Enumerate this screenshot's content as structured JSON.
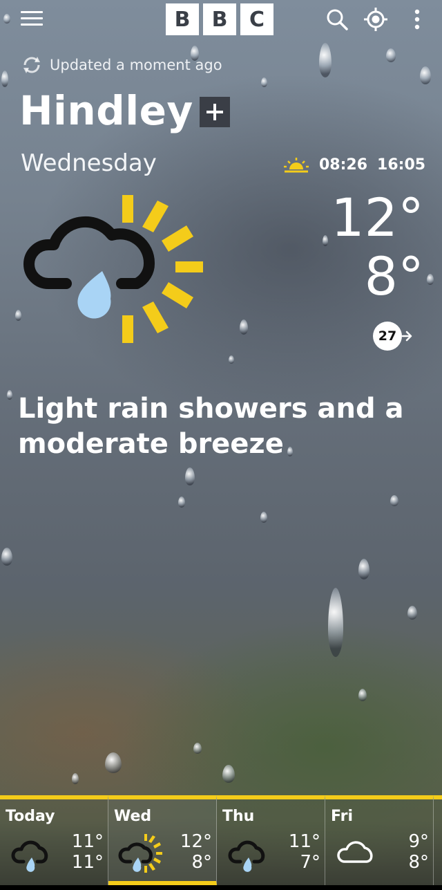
{
  "header": {
    "logo_letters": [
      "B",
      "B",
      "C"
    ],
    "menu_icon": "hamburger-menu-icon",
    "search_icon": "search-icon",
    "locate_icon": "locate-icon",
    "more_icon": "more-vertical-icon"
  },
  "status": {
    "updated_text": "Updated a moment ago"
  },
  "location": {
    "name": "Hindley"
  },
  "today": {
    "day": "Wednesday",
    "sunrise": "08:26",
    "sunset": "16:05",
    "high": "12°",
    "low": "8°",
    "wind_speed": "27",
    "summary": "Light rain showers and a moderate breeze",
    "weather_icon": "light-rain-showers-sun-icon"
  },
  "forecast": [
    {
      "day": "Today",
      "high": "11°",
      "low": "11°",
      "icon": "light-rain-cloud-icon"
    },
    {
      "day": "Wed",
      "high": "12°",
      "low": "8°",
      "icon": "light-rain-showers-sun-icon"
    },
    {
      "day": "Thu",
      "high": "11°",
      "low": "7°",
      "icon": "light-rain-cloud-icon"
    },
    {
      "day": "Fri",
      "high": "9°",
      "low": "8°",
      "icon": "cloud-icon"
    }
  ],
  "colors": {
    "sun_yellow": "#f4cc1a",
    "rain_blue": "#a9d4f5",
    "logo_text": "#3a3f47"
  }
}
